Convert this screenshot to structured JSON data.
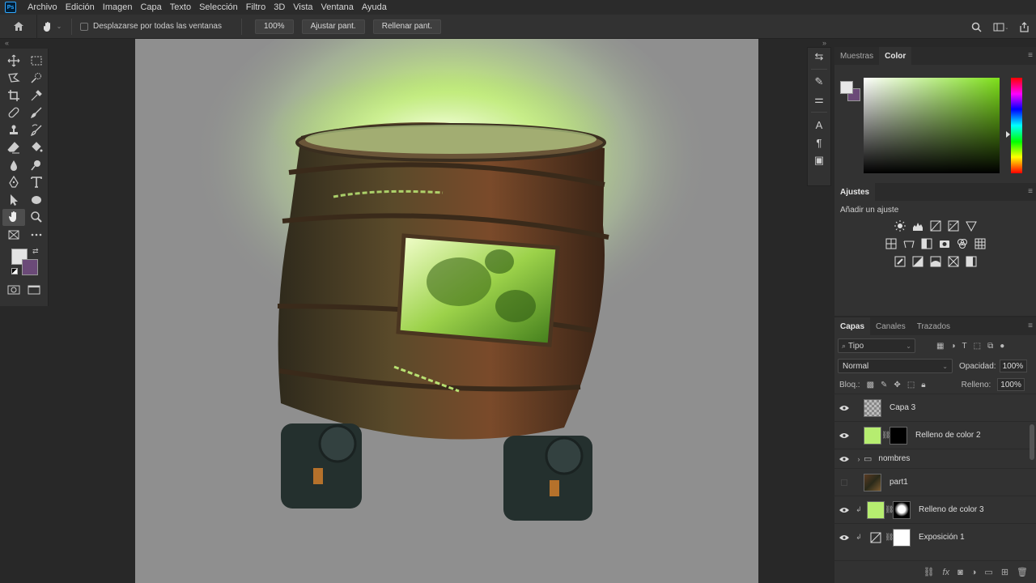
{
  "app": {
    "logo_text": "Ps"
  },
  "menu": [
    "Archivo",
    "Edición",
    "Imagen",
    "Capa",
    "Texto",
    "Selección",
    "Filtro",
    "3D",
    "Vista",
    "Ventana",
    "Ayuda"
  ],
  "options": {
    "scroll_all_label": "Desplazarse por todas las ventanas",
    "zoom": "100%",
    "fit_screen": "Ajustar pant.",
    "fill_screen": "Rellenar pant."
  },
  "color_panel": {
    "tabs": [
      "Muestras",
      "Color"
    ],
    "active_tab": "Color",
    "fg": "#e8e8e8",
    "bg": "#6b4a78"
  },
  "adjustments": {
    "tab": "Ajustes",
    "add_label": "Añadir un ajuste"
  },
  "layers_panel": {
    "tabs": [
      "Capas",
      "Canales",
      "Trazados"
    ],
    "active_tab": "Capas",
    "filter": "Tipo",
    "blend_mode": "Normal",
    "opacity_label": "Opacidad:",
    "opacity": "100%",
    "lock_label": "Bloq.:",
    "fill_label": "Relleno:",
    "fill": "100%",
    "layers": [
      {
        "name": "Capa 3",
        "visible": true
      },
      {
        "name": "Relleno de color 2",
        "visible": true
      },
      {
        "name": "nombres",
        "visible": true
      },
      {
        "name": "part1",
        "visible": false
      },
      {
        "name": "Relleno de color 3",
        "visible": true
      },
      {
        "name": "Exposición 1",
        "visible": true
      }
    ]
  }
}
